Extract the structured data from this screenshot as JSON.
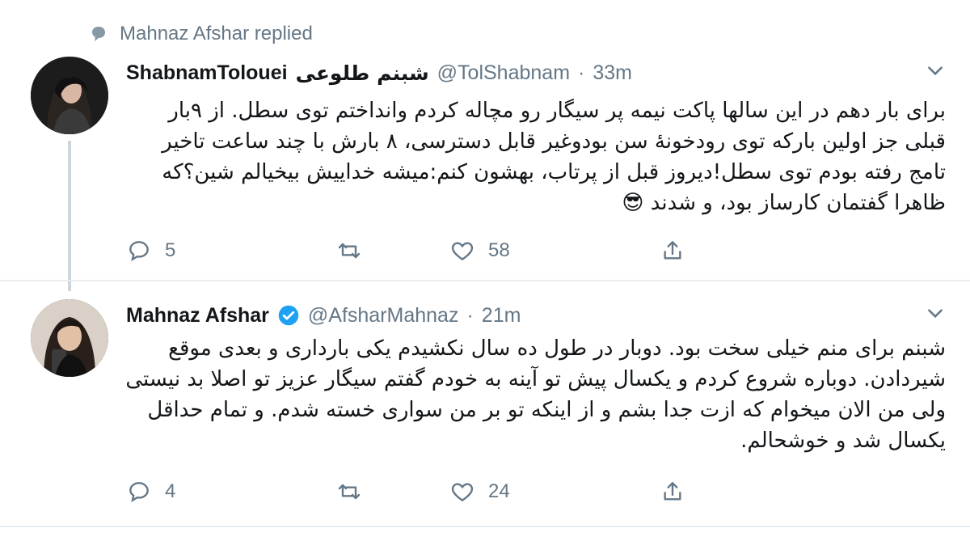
{
  "reply_context": {
    "text": "Mahnaz Afshar replied",
    "icon": "speech-bubble-icon"
  },
  "tweets": [
    {
      "display_name": "ShabnamTolouei",
      "display_name_fa": "شبنم طلوعی",
      "handle": "@TolShabnam",
      "separator": "·",
      "time": "33m",
      "verified": false,
      "text": "برای بار دهم در این سالها پاکت نیمه پر سیگار رو مچاله کردم وانداختم توی سطل. از ۹بار قبلی جز اولین بارکه توی رودخونهٔ سن بودوغیر قابل دسترسی، ۸ بارش با چند ساعت تاخیر تامج رفته بودم توی سطل!دیروز قبل از پرتاب، بهشون کنم:میشه خداییش بیخیالم شین؟که ظاهرا گفتمان کارساز بود، و شدند 😎",
      "stats": {
        "replies": "5",
        "retweets": "",
        "likes": "58"
      }
    },
    {
      "display_name": "Mahnaz Afshar",
      "handle": "@AfsharMahnaz",
      "separator": "·",
      "time": "21m",
      "verified": true,
      "text": "شبنم برای منم خیلی سخت بود. دوبار در طول ده سال نکشیدم یکی بارداری و بعدی موقع شیردادن. دوباره شروع کردم و یکسال پیش تو آینه به خودم گفتم سیگار عزیز تو اصلا بد نیستی ولی من الان میخوام که ازت جدا بشم و از اینکه تو بر من سواری خسته شدم. و تمام حداقل یکسال شد و خوشحالم.",
      "stats": {
        "replies": "4",
        "retweets": "",
        "likes": "24"
      }
    }
  ],
  "colors": {
    "text": "#14171a",
    "secondary": "#657786",
    "verified": "#1da1f2",
    "divider": "#e6ecf0"
  }
}
